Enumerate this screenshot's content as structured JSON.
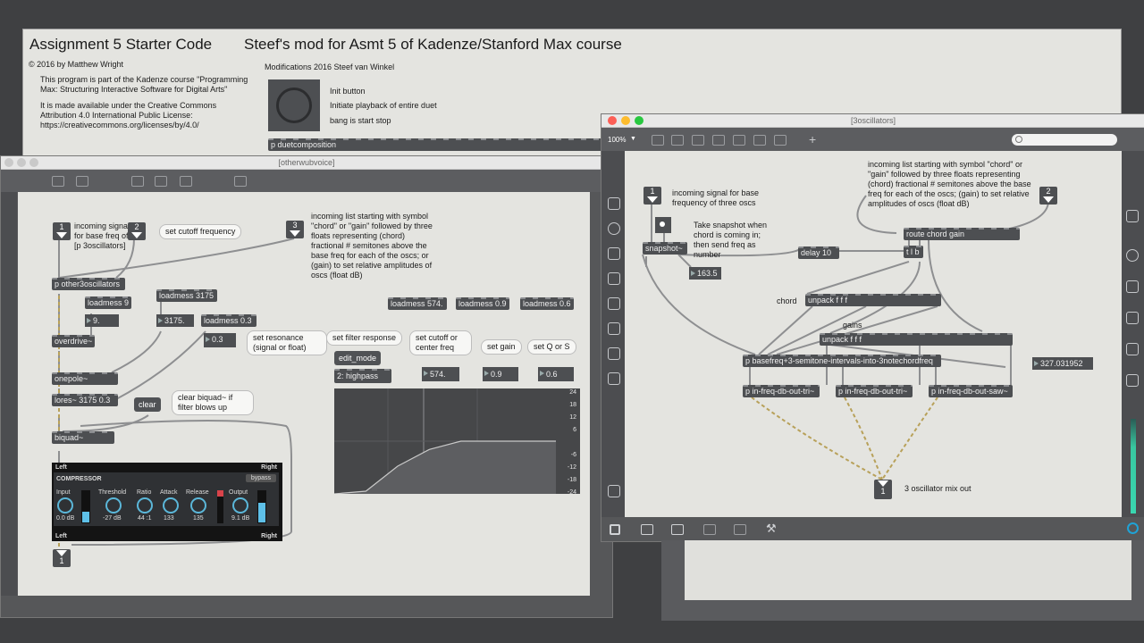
{
  "bg_window": {
    "title": "Assignment 5 Starter Code",
    "subtitle": "Steef's mod for Asmt 5 of Kadenze/Stanford Max course",
    "copyright": "© 2016 by Matthew Wright",
    "para1": "This program is part of the Kadenze course \"Programming Max: Structuring Interactive Software for Digital Arts\"",
    "para2": "It is made available under the Creative Commons Attribution 4.0 International Public License: https://creativecommons.org/licenses/by/4.0/",
    "mods": "Modifications 2016 Steef van Winkel",
    "init_button": "Init button",
    "initiate": "Initiate playback of entire duet",
    "bang": "bang is start stop",
    "duet": "p duetcomposition"
  },
  "wub": {
    "title": "[otherwubvoice]",
    "inlet1": "1",
    "inlet2": "2",
    "inlet3": "3",
    "inlet1_comment": "incoming signal for base freq of [p 3oscillators]",
    "cutoff_bubble": "set cutoff frequency",
    "chord_comment": "incoming list starting with symbol \"chord\" or \"gain\" followed by three floats representing (chord) fractional # semitones above the base freq for each of the oscs; or (gain) to set relative amplitudes of oscs (float dB)",
    "other3osc": "p other3oscillators",
    "loadmess9": "loadmess 9",
    "num9": "9.",
    "loadmess3175": "loadmess 3175",
    "num3175": "3175.",
    "loadmess03": "loadmess 0.3",
    "num03": "0.3",
    "resonance_bubble": "set resonance (signal or float)",
    "overdrive": "overdrive~",
    "onepole": "onepole~",
    "lores": "lores~ 3175 0.3",
    "clear": "clear",
    "clear_bubble": "clear biquad~ if filter blows up",
    "biquad": "biquad~",
    "filter_resp_bubble": "set filter response",
    "edit_mode": "edit_mode",
    "highpass": "2: highpass",
    "cutoff_center_bubble": "set cutoff or center freq",
    "gain_bubble": "set gain",
    "q_bubble": "set Q or S",
    "loadmess574": "loadmess 574.",
    "loadmess09": "loadmess 0.9",
    "loadmess06": "loadmess 0.6",
    "num574": "574.",
    "num09": "0.9",
    "num06": "0.6",
    "db_ticks": [
      "24",
      "18",
      "12",
      "6",
      "-6",
      "-12",
      "-18",
      "-24"
    ],
    "comp": {
      "left": "Left",
      "right": "Right",
      "name": "COMPRESSOR",
      "bypass": "bypass",
      "input_label": "Input",
      "input_val": "0.0 dB",
      "threshold_label": "Threshold",
      "threshold_val": "-27 dB",
      "ratio_label": "Ratio",
      "ratio_val": "44 :1",
      "attack_label": "Attack",
      "attack_val": "133",
      "release_label": "Release",
      "release_val": "135",
      "output_label": "Output",
      "output_val": "9.1 dB"
    },
    "outlet1": "1"
  },
  "osc": {
    "title": "[3oscillators]",
    "zoom": "100%",
    "inlet1": "1",
    "inlet2": "2",
    "inlet1_comment": "incoming signal for base frequency of three oscs",
    "chord_comment": "incoming list starting with symbol \"chord\" or \"gain\" followed by three floats representing (chord) fractional # semitones above the base freq for each of the oscs; (gain) to set relative amplitudes of oscs (float dB)",
    "snapshot_comment": "Take snapshot when chord is coming in; then send freq as number",
    "snapshot": "snapshot~",
    "num1635": "163.5",
    "delay": "delay 10",
    "route": "route chord gain",
    "tb": "t l b",
    "chord_label": "chord",
    "unpack1": "unpack f f f",
    "gains_label": "gains",
    "unpack2": "unpack f f f",
    "basefreq": "p basefreq+3-semitone-intervals-into-3notechordfreq",
    "num327": "327.031952",
    "tri1": "p in-freq-db-out-tri~",
    "tri2": "p in-freq-db-out-tri~",
    "saw": "p in-freq-db-out-saw~",
    "outlet1": "1",
    "outlet_comment": "3 oscillator mix out"
  },
  "chart_data": {
    "type": "line",
    "title": "",
    "xlabel": "",
    "ylabel": "",
    "ylim": [
      -24,
      24
    ],
    "yticks": [
      24,
      18,
      12,
      6,
      -6,
      -12,
      -18,
      -24
    ],
    "series": [
      {
        "values_db": [
          -30,
          -24,
          -12,
          -4,
          0,
          0,
          0,
          0
        ]
      }
    ]
  }
}
